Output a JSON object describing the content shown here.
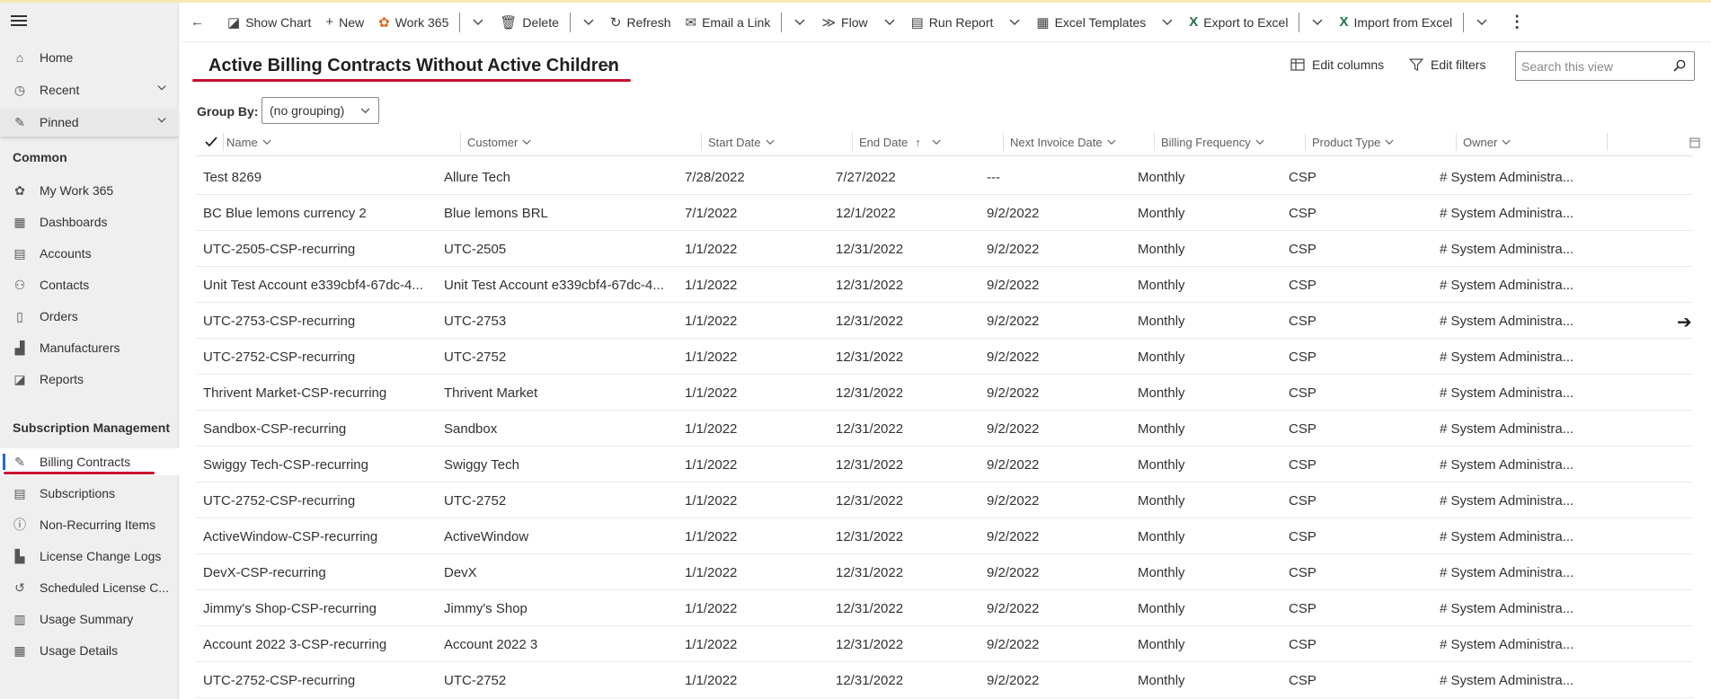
{
  "toolbar": {
    "show_chart": "Show Chart",
    "new": "New",
    "work365": "Work 365",
    "delete": "Delete",
    "refresh": "Refresh",
    "email_link": "Email a Link",
    "flow": "Flow",
    "run_report": "Run Report",
    "excel_templates": "Excel Templates",
    "export_excel": "Export to Excel",
    "import_excel": "Import from Excel"
  },
  "sidebar": {
    "top": [
      {
        "label": "Home",
        "icon": "home-icon"
      },
      {
        "label": "Recent",
        "icon": "clock-icon"
      },
      {
        "label": "Pinned",
        "icon": "pin-icon"
      }
    ],
    "common_header": "Common",
    "common": [
      {
        "label": "My Work 365",
        "icon": "gear-icon"
      },
      {
        "label": "Dashboards",
        "icon": "dashboard-icon"
      },
      {
        "label": "Accounts",
        "icon": "building-icon"
      },
      {
        "label": "Contacts",
        "icon": "person-icon"
      },
      {
        "label": "Orders",
        "icon": "document-icon"
      },
      {
        "label": "Manufacturers",
        "icon": "factory-icon"
      },
      {
        "label": "Reports",
        "icon": "chart-icon"
      }
    ],
    "subs_header": "Subscription Management",
    "subs": [
      {
        "label": "Billing Contracts",
        "icon": "edit-icon"
      },
      {
        "label": "Subscriptions",
        "icon": "list-icon"
      },
      {
        "label": "Non-Recurring Items",
        "icon": "info-icon"
      },
      {
        "label": "License Change Logs",
        "icon": "log-icon"
      },
      {
        "label": "Scheduled License C...",
        "icon": "history-icon"
      },
      {
        "label": "Usage Summary",
        "icon": "summary-icon"
      },
      {
        "label": "Usage Details",
        "icon": "table-icon"
      }
    ]
  },
  "view": {
    "title": "Active Billing Contracts Without Active Children",
    "edit_columns": "Edit columns",
    "edit_filters": "Edit filters",
    "search_placeholder": "Search this view",
    "group_by_label": "Group By:",
    "group_by_value": "(no grouping)"
  },
  "columns": [
    "Name",
    "Customer",
    "Start Date",
    "End Date",
    "Next Invoice Date",
    "Billing Frequency",
    "Product Type",
    "Owner"
  ],
  "rows": [
    [
      "Test 8269",
      "Allure Tech",
      "7/28/2022",
      "7/27/2022",
      "---",
      "Monthly",
      "CSP",
      "# System Administra..."
    ],
    [
      "BC  Blue lemons  currency 2",
      "Blue lemons BRL",
      "7/1/2022",
      "12/1/2022",
      "9/2/2022",
      "Monthly",
      "CSP",
      "# System Administra..."
    ],
    [
      "UTC-2505-CSP-recurring",
      "UTC-2505",
      "1/1/2022",
      "12/31/2022",
      "9/2/2022",
      "Monthly",
      "CSP",
      "# System Administra..."
    ],
    [
      "Unit Test Account e339cbf4-67dc-4...",
      "Unit Test Account e339cbf4-67dc-4...",
      "1/1/2022",
      "12/31/2022",
      "9/2/2022",
      "Monthly",
      "CSP",
      "# System Administra..."
    ],
    [
      "UTC-2753-CSP-recurring",
      "UTC-2753",
      "1/1/2022",
      "12/31/2022",
      "9/2/2022",
      "Monthly",
      "CSP",
      "# System Administra..."
    ],
    [
      "UTC-2752-CSP-recurring",
      "UTC-2752",
      "1/1/2022",
      "12/31/2022",
      "9/2/2022",
      "Monthly",
      "CSP",
      "# System Administra..."
    ],
    [
      "Thrivent Market-CSP-recurring",
      "Thrivent Market",
      "1/1/2022",
      "12/31/2022",
      "9/2/2022",
      "Monthly",
      "CSP",
      "# System Administra..."
    ],
    [
      "Sandbox-CSP-recurring",
      "Sandbox",
      "1/1/2022",
      "12/31/2022",
      "9/2/2022",
      "Monthly",
      "CSP",
      "# System Administra..."
    ],
    [
      "Swiggy Tech-CSP-recurring",
      "Swiggy Tech",
      "1/1/2022",
      "12/31/2022",
      "9/2/2022",
      "Monthly",
      "CSP",
      "# System Administra..."
    ],
    [
      "UTC-2752-CSP-recurring",
      "UTC-2752",
      "1/1/2022",
      "12/31/2022",
      "9/2/2022",
      "Monthly",
      "CSP",
      "# System Administra..."
    ],
    [
      "ActiveWindow-CSP-recurring",
      "ActiveWindow",
      "1/1/2022",
      "12/31/2022",
      "9/2/2022",
      "Monthly",
      "CSP",
      "# System Administra..."
    ],
    [
      "DevX-CSP-recurring",
      "DevX",
      "1/1/2022",
      "12/31/2022",
      "9/2/2022",
      "Monthly",
      "CSP",
      "# System Administra..."
    ],
    [
      "Jimmy's Shop-CSP-recurring",
      "Jimmy's Shop",
      "1/1/2022",
      "12/31/2022",
      "9/2/2022",
      "Monthly",
      "CSP",
      "# System Administra..."
    ],
    [
      "Account 2022 3-CSP-recurring",
      "Account 2022 3",
      "1/1/2022",
      "12/31/2022",
      "9/2/2022",
      "Monthly",
      "CSP",
      "# System Administra..."
    ],
    [
      "UTC-2752-CSP-recurring",
      "UTC-2752",
      "1/1/2022",
      "12/31/2022",
      "9/2/2022",
      "Monthly",
      "CSP",
      "# System Administra..."
    ]
  ],
  "colors": {
    "accent": "#2266e3",
    "highlight": "#c8102e",
    "excel": "#217346"
  }
}
